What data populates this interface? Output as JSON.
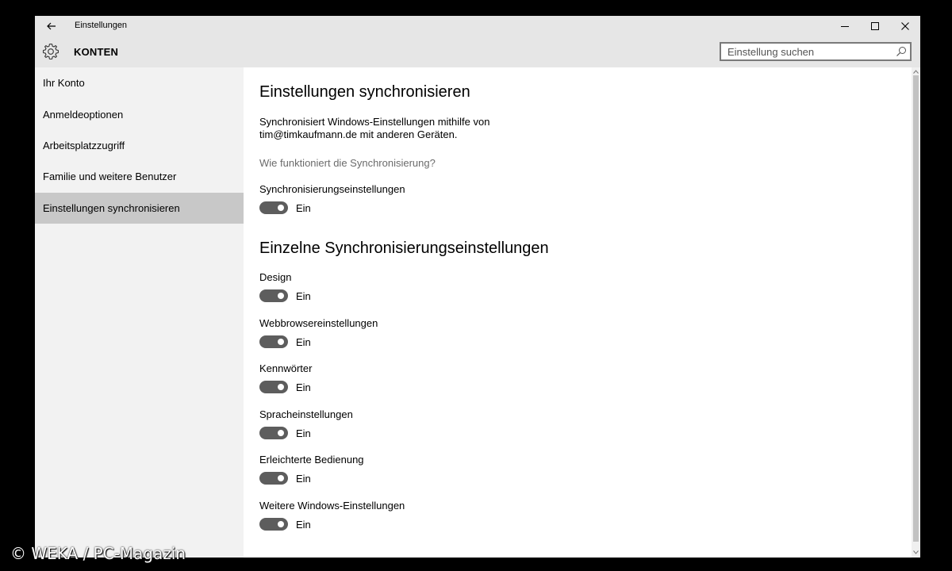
{
  "window": {
    "title": "Einstellungen"
  },
  "header": {
    "section_title": "KONTEN",
    "search_placeholder": "Einstellung suchen"
  },
  "sidebar": {
    "items": [
      {
        "label": "Ihr Konto"
      },
      {
        "label": "Anmeldeoptionen"
      },
      {
        "label": "Arbeitsplatzzugriff"
      },
      {
        "label": "Familie und weitere Benutzer"
      },
      {
        "label": "Einstellungen synchronisieren",
        "selected": true
      }
    ]
  },
  "main": {
    "heading": "Einstellungen synchronisieren",
    "description_line1": "Synchronisiert Windows-Einstellungen mithilfe von",
    "description_line2": "tim@timkaufmann.de mit anderen Geräten.",
    "help_link": "Wie funktioniert die Synchronisierung?",
    "master_toggle": {
      "label": "Synchronisierungseinstellungen",
      "state": "Ein"
    },
    "subheading": "Einzelne Synchronisierungseinstellungen",
    "toggles": [
      {
        "label": "Design",
        "state": "Ein"
      },
      {
        "label": "Webbrowsereinstellungen",
        "state": "Ein"
      },
      {
        "label": "Kennwörter",
        "state": "Ein"
      },
      {
        "label": "Spracheinstellungen",
        "state": "Ein"
      },
      {
        "label": "Erleichterte Bedienung",
        "state": "Ein"
      },
      {
        "label": "Weitere Windows-Einstellungen",
        "state": "Ein"
      }
    ]
  },
  "icons": {
    "back": "back-arrow-icon",
    "gear": "gear-icon",
    "search": "search-icon",
    "minimize": "minimize-icon",
    "maximize": "maximize-icon",
    "close": "close-icon"
  },
  "colors": {
    "toggle_on": "#5d5d5d",
    "sidebar_selected": "#c8c8c8",
    "chrome": "#e6e6e6"
  },
  "watermark": "© WEKA / PC-Magazin"
}
